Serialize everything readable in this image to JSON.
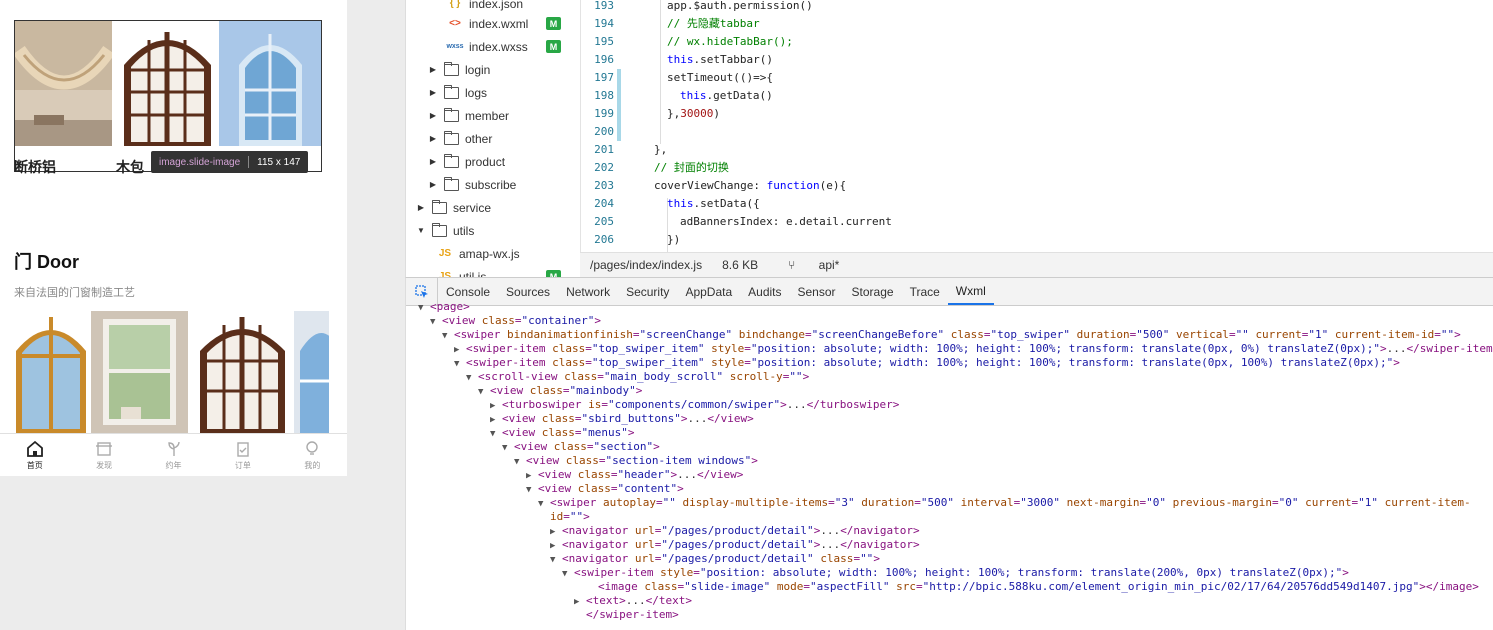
{
  "simulator": {
    "section1": {
      "captions": [
        "断桥铝",
        "木包"
      ],
      "tooltip": {
        "selector": "image.slide-image",
        "size": "115 x 147"
      }
    },
    "door": {
      "title": "门 Door",
      "subtitle": "来自法国的门窗制造工艺"
    },
    "tabbar": [
      {
        "label": "首页",
        "icon": "home-icon",
        "active": true
      },
      {
        "label": "发现",
        "icon": "discover-icon",
        "active": false
      },
      {
        "label": "约年",
        "icon": "sprout-icon",
        "active": false
      },
      {
        "label": "订单",
        "icon": "clipboard-icon",
        "active": false
      },
      {
        "label": "我的",
        "icon": "bulb-icon",
        "active": false
      }
    ]
  },
  "file_tree": [
    {
      "name": "index.json",
      "type": "json",
      "icon": "{ }",
      "color": "#d4a017"
    },
    {
      "name": "index.wxml",
      "type": "wxml",
      "icon": "<>",
      "color": "#e44d26",
      "badge": "M"
    },
    {
      "name": "index.wxss",
      "type": "wxss",
      "icon": "wxss",
      "color": "#2b6cb0",
      "badge": "M"
    },
    {
      "name": "login",
      "type": "folder",
      "arrow": "▶"
    },
    {
      "name": "logs",
      "type": "folder",
      "arrow": "▶"
    },
    {
      "name": "member",
      "type": "folder",
      "arrow": "▶"
    },
    {
      "name": "other",
      "type": "folder",
      "arrow": "▶"
    },
    {
      "name": "product",
      "type": "folder",
      "arrow": "▶"
    },
    {
      "name": "subscribe",
      "type": "folder",
      "arrow": "▶"
    },
    {
      "name": "service",
      "type": "folder",
      "arrow": "▶"
    },
    {
      "name": "utils",
      "type": "folder-open",
      "arrow": "▼"
    },
    {
      "name": "amap-wx.js",
      "type": "js",
      "icon": "JS",
      "color": "#e8a317"
    },
    {
      "name": "util.js",
      "type": "js",
      "icon": "JS",
      "color": "#e8a317",
      "badge": "M"
    }
  ],
  "code": [
    {
      "n": "193",
      "t": "app.$auth.permission()"
    },
    {
      "n": "194",
      "t": "// 先隐藏tabbar",
      "comment": true
    },
    {
      "n": "195",
      "t": "// wx.hideTabBar();",
      "comment": true
    },
    {
      "n": "196",
      "t": "this.setTabbar()"
    },
    {
      "n": "197",
      "t": "setTimeout(()=>{"
    },
    {
      "n": "198",
      "t": "  this.getData()"
    },
    {
      "n": "199",
      "t": "},30000)"
    },
    {
      "n": "200",
      "t": ""
    },
    {
      "n": "201",
      "t": "},"
    },
    {
      "n": "202",
      "t": "// 封面的切换",
      "comment": true
    },
    {
      "n": "203",
      "t": "coverViewChange: function(e){"
    },
    {
      "n": "204",
      "t": "  this.setData({"
    },
    {
      "n": "205",
      "t": "    adBannersIndex: e.detail.current"
    },
    {
      "n": "206",
      "t": "  })"
    }
  ],
  "statusbar": {
    "path": "/pages/index/index.js",
    "size": "8.6 KB",
    "branch": "api*"
  },
  "devtools": {
    "tabs": [
      "Console",
      "Sources",
      "Network",
      "Security",
      "AppData",
      "Audits",
      "Sensor",
      "Storage",
      "Trace",
      "Wxml"
    ],
    "active_tab": "Wxml",
    "lines": [
      {
        "tri": "▼",
        "html": "<span class=\"tg\">&lt;page&gt;</span>"
      },
      {
        "tri": "▼",
        "html": "<span class=\"tg\">&lt;view</span> <span class=\"an\">class</span>=<span class=\"av\">\"container\"</span><span class=\"tg\">&gt;</span>"
      },
      {
        "tri": "▼",
        "html": "<span class=\"tg\">&lt;swiper</span> <span class=\"an\">bindanimationfinish</span>=<span class=\"av\">\"screenChange\"</span> <span class=\"an\">bindchange</span>=<span class=\"av\">\"screenChangeBefore\"</span> <span class=\"an\">class</span>=<span class=\"av\">\"top_swiper\"</span> <span class=\"an\">duration</span>=<span class=\"av\">\"500\"</span> <span class=\"an\">vertical</span>=<span class=\"av\">\"\"</span> <span class=\"an\">current</span>=<span class=\"av\">\"1\"</span> <span class=\"an\">current-item-id</span>=<span class=\"av\">\"\"</span><span class=\"tg\">&gt;</span>"
      },
      {
        "tri": "▶",
        "html": "<span class=\"tg\">&lt;swiper-item</span> <span class=\"an\">class</span>=<span class=\"av\">\"top_swiper_item\"</span> <span class=\"an\">style</span>=<span class=\"av\">\"position: absolute; width: 100%; height: 100%; transform: translate(0px, 0%) translateZ(0px);\"</span><span class=\"tg\">&gt;</span><span class=\"ct\">...</span><span class=\"tg\">&lt;/swiper-item</span>"
      },
      {
        "tri": "▼",
        "html": "<span class=\"tg\">&lt;swiper-item</span> <span class=\"an\">class</span>=<span class=\"av\">\"top_swiper_item\"</span> <span class=\"an\">style</span>=<span class=\"av\">\"position: absolute; width: 100%; height: 100%; transform: translate(0px, 100%) translateZ(0px);\"</span><span class=\"tg\">&gt;</span>"
      },
      {
        "tri": "▼",
        "html": "<span class=\"tg\">&lt;scroll-view</span> <span class=\"an\">class</span>=<span class=\"av\">\"main_body_scroll\"</span> <span class=\"an\">scroll-y</span>=<span class=\"av\">\"\"</span><span class=\"tg\">&gt;</span>"
      },
      {
        "tri": "▼",
        "html": "<span class=\"tg\">&lt;view</span> <span class=\"an\">class</span>=<span class=\"av\">\"mainbody\"</span><span class=\"tg\">&gt;</span>"
      },
      {
        "tri": "▶",
        "html": "<span class=\"tg\">&lt;turboswiper</span> <span class=\"an\">is</span>=<span class=\"av\">\"components/common/swiper\"</span><span class=\"tg\">&gt;</span><span class=\"ct\">...</span><span class=\"tg\">&lt;/turboswiper&gt;</span>"
      },
      {
        "tri": "▶",
        "html": "<span class=\"tg\">&lt;view</span> <span class=\"an\">class</span>=<span class=\"av\">\"sbird_buttons\"</span><span class=\"tg\">&gt;</span><span class=\"ct\">...</span><span class=\"tg\">&lt;/view&gt;</span>"
      },
      {
        "tri": "▼",
        "html": "<span class=\"tg\">&lt;view</span> <span class=\"an\">class</span>=<span class=\"av\">\"menus\"</span><span class=\"tg\">&gt;</span>"
      },
      {
        "tri": "▼",
        "html": "<span class=\"tg\">&lt;view</span> <span class=\"an\">class</span>=<span class=\"av\">\"section\"</span><span class=\"tg\">&gt;</span>"
      },
      {
        "tri": "▼",
        "html": "<span class=\"tg\">&lt;view</span> <span class=\"an\">class</span>=<span class=\"av\">\"section-item windows\"</span><span class=\"tg\">&gt;</span>"
      },
      {
        "tri": "▶",
        "html": "<span class=\"tg\">&lt;view</span> <span class=\"an\">class</span>=<span class=\"av\">\"header\"</span><span class=\"tg\">&gt;</span><span class=\"ct\">...</span><span class=\"tg\">&lt;/view&gt;</span>"
      },
      {
        "tri": "▼",
        "html": "<span class=\"tg\">&lt;view</span> <span class=\"an\">class</span>=<span class=\"av\">\"content\"</span><span class=\"tg\">&gt;</span>"
      },
      {
        "tri": "▼",
        "html": "<span class=\"tg\">&lt;swiper</span> <span class=\"an\">autoplay</span>=<span class=\"av\">\"\"</span> <span class=\"an\">display-multiple-items</span>=<span class=\"av\">\"3\"</span> <span class=\"an\">duration</span>=<span class=\"av\">\"500\"</span> <span class=\"an\">interval</span>=<span class=\"av\">\"3000\"</span> <span class=\"an\">next-margin</span>=<span class=\"av\">\"0\"</span> <span class=\"an\">previous-margin</span>=<span class=\"av\">\"0\"</span> <span class=\"an\">current</span>=<span class=\"av\">\"1\"</span> <span class=\"an\">current-item-</span>"
      },
      {
        "tri": "",
        "html": "<span class=\"an\">id</span>=<span class=\"av\">\"\"</span><span class=\"tg\">&gt;</span>"
      },
      {
        "tri": "▶",
        "html": "<span class=\"tg\">&lt;navigator</span> <span class=\"an\">url</span>=<span class=\"av\">\"/pages/product/detail\"</span><span class=\"tg\">&gt;</span><span class=\"ct\">...</span><span class=\"tg\">&lt;/navigator&gt;</span>"
      },
      {
        "tri": "▶",
        "html": "<span class=\"tg\">&lt;navigator</span> <span class=\"an\">url</span>=<span class=\"av\">\"/pages/product/detail\"</span><span class=\"tg\">&gt;</span><span class=\"ct\">...</span><span class=\"tg\">&lt;/navigator&gt;</span>"
      },
      {
        "tri": "▼",
        "html": "<span class=\"tg\">&lt;navigator</span> <span class=\"an\">url</span>=<span class=\"av\">\"/pages/product/detail\"</span> <span class=\"an\">class</span>=<span class=\"av\">\"\"</span><span class=\"tg\">&gt;</span>"
      },
      {
        "tri": "▼",
        "html": "<span class=\"tg\">&lt;swiper-item</span> <span class=\"an\">style</span>=<span class=\"av\">\"position: absolute; width: 100%; height: 100%; transform: translate(200%, 0px) translateZ(0px);\"</span><span class=\"tg\">&gt;</span>"
      },
      {
        "tri": "",
        "html": "<span class=\"tg\">&lt;image</span> <span class=\"an\">class</span>=<span class=\"av\">\"slide-image\"</span> <span class=\"an\">mode</span>=<span class=\"av\">\"aspectFill\"</span> <span class=\"an\">src</span>=<span class=\"av\">\"http://bpic.588ku.com/element_origin_min_pic/02/17/64/20576dd549d1407.jpg\"</span><span class=\"tg\">&gt;&lt;/image&gt;</span>"
      },
      {
        "tri": "▶",
        "html": "<span class=\"tg\">&lt;text&gt;</span><span class=\"ct\">...</span><span class=\"tg\">&lt;/text&gt;</span>"
      },
      {
        "tri": "",
        "html": "<span class=\"tg\">&lt;/swiper-item&gt;</span>"
      }
    ]
  }
}
